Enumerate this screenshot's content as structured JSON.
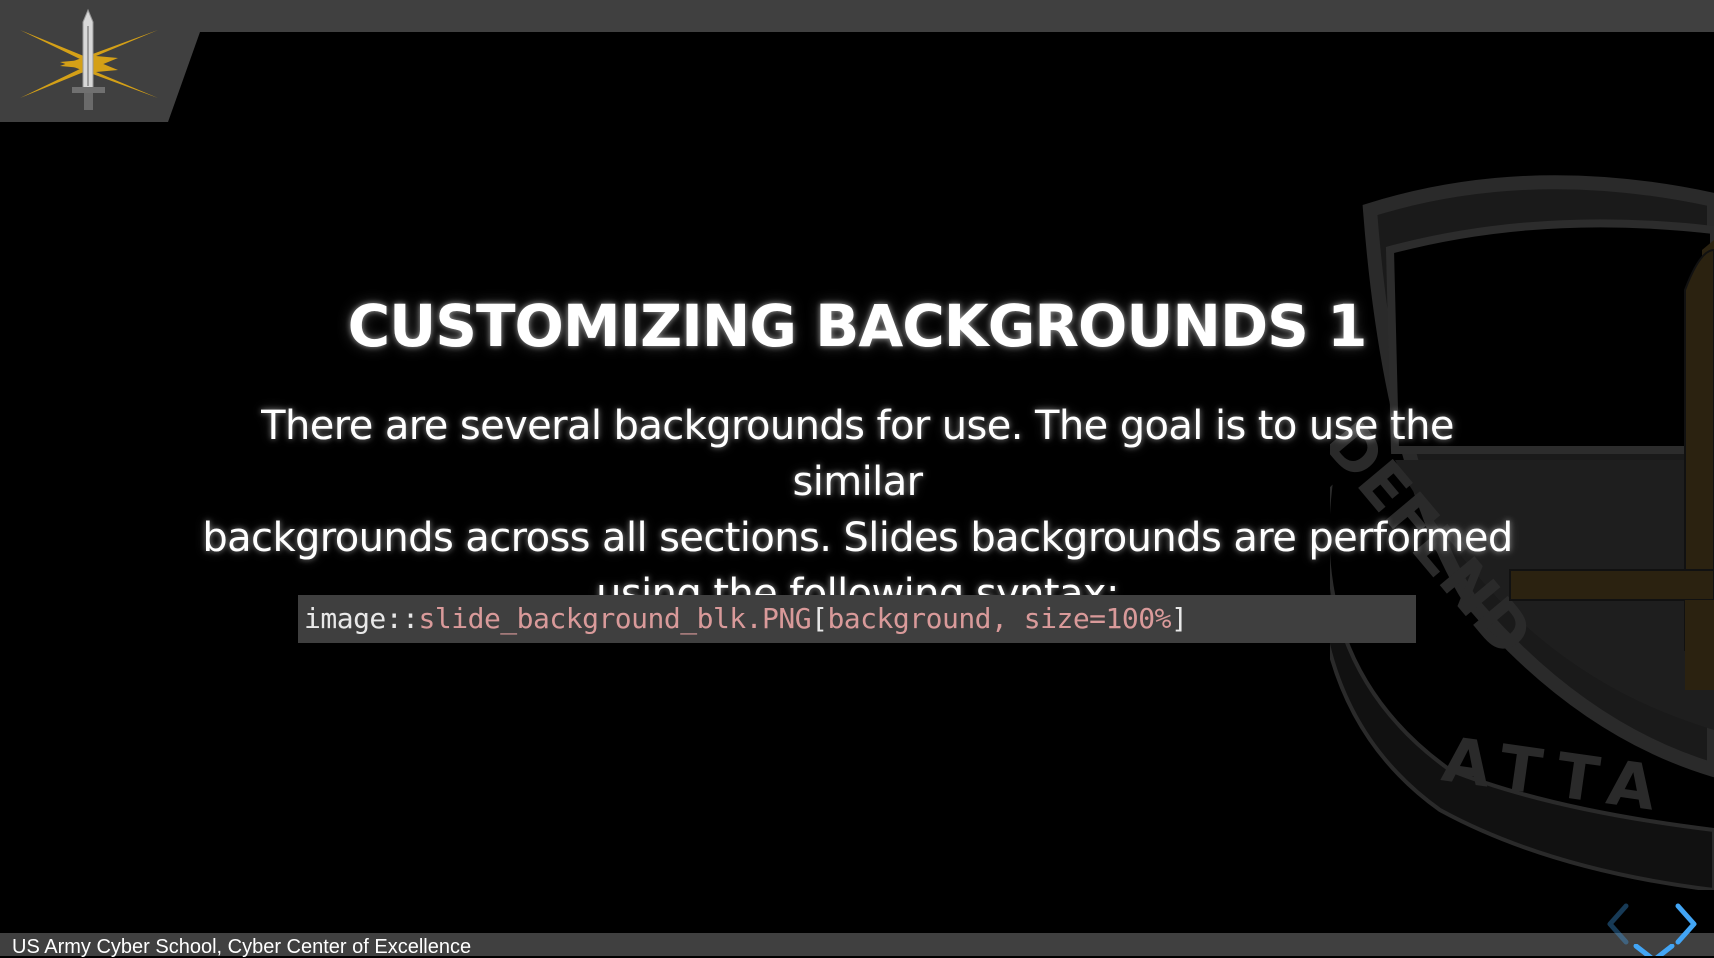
{
  "slide": {
    "title": "CUSTOMIZING BACKGROUNDS 1",
    "body_lines": [
      "There are several backgrounds for use. The goal is to use the similar",
      "backgrounds across all sections. Slides backgrounds are performed",
      "using the following syntax:"
    ],
    "code": {
      "macro": "image::",
      "target": "slide_background_blk.PNG",
      "open_bracket": "[",
      "attributes": "background, size=100%",
      "close_bracket": "]"
    }
  },
  "footer": {
    "text": "US Army Cyber School, Cyber Center of Excellence"
  },
  "crest": {
    "motto_left": "DEFEND",
    "motto_bottom": "ATTA"
  },
  "navigation": {
    "prev": "previous-slide",
    "next": "next-slide",
    "down": "down-slide"
  },
  "colors": {
    "bar": "#404040",
    "accent": "#42a5f5",
    "lightning": "#d4a017",
    "code_string": "#d99a9a"
  }
}
